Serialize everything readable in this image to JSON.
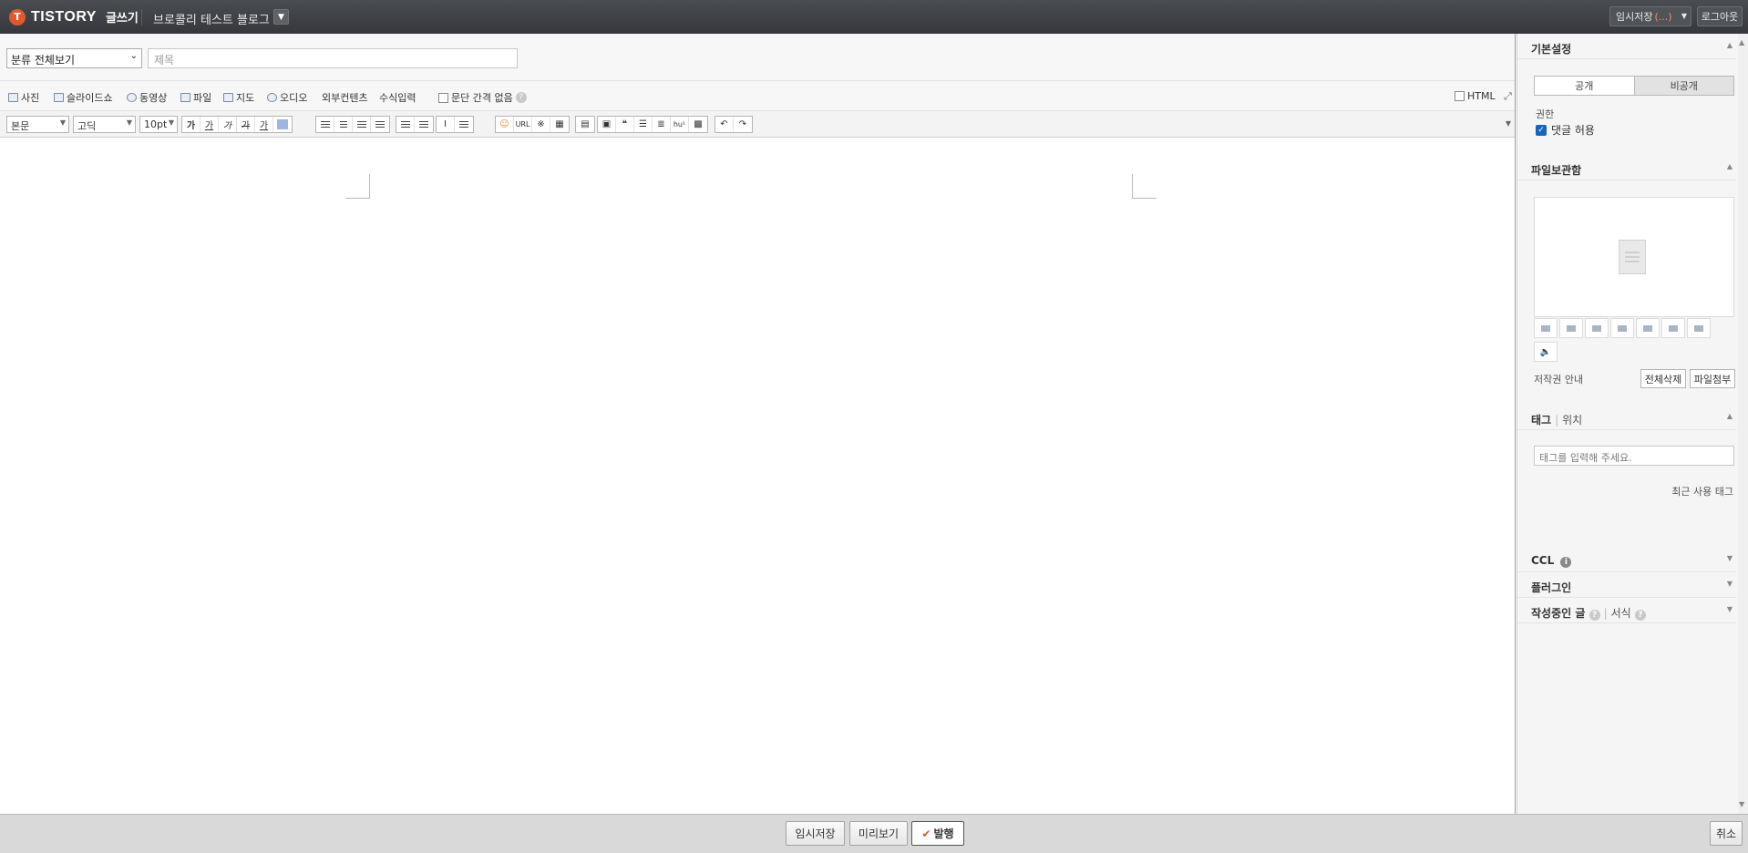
{
  "topbar": {
    "logo_text": "TISTORY",
    "logo_mark": "T",
    "logo_sub": "글쓰기",
    "blog_name": "브로콜리 테스트 블로그",
    "temp_save_label": "임시저장",
    "temp_save_count": "(...)",
    "logout_label": "로그아웃"
  },
  "editor": {
    "category_value": "분류 전체보기",
    "title_placeholder": "제목",
    "insert": {
      "photo": "사진",
      "slideshow": "슬라이드쇼",
      "video": "동영상",
      "file": "파일",
      "map": "지도",
      "audio": "오디오",
      "external": "외부컨텐츠",
      "formula": "수식입력",
      "no_paragraph_spacing": "문단 간격 없음",
      "html": "HTML"
    },
    "format": {
      "paragraph_style": "본문",
      "font": "고딕",
      "font_size": "10pt",
      "bold": "가",
      "underline": "가",
      "italic": "가",
      "strike": "가",
      "color": "가",
      "link_url": "URL",
      "hanja": "hu¹"
    }
  },
  "sidebar": {
    "basic_settings": "기본설정",
    "public_label": "공개",
    "private_label": "비공개",
    "permission_label": "권한",
    "allow_comments_label": "댓글 허용",
    "file_storage": "파일보관함",
    "copyright_label": "저작권 안내",
    "delete_all_label": "전체삭제",
    "attach_file_label": "파일첨부",
    "tag_label": "태그",
    "location_label": "위치",
    "tag_placeholder": "태그를 입력해 주세요.",
    "recent_tags_label": "최근 사용 태그",
    "ccl_label": "CCL",
    "plugin_label": "플러그인",
    "drafts_label": "작성중인 글",
    "template_label": "서식"
  },
  "bottombar": {
    "temp_save": "임시저장",
    "preview": "미리보기",
    "publish": "발행",
    "cancel": "취소"
  },
  "colors": {
    "brand": "#e4572e",
    "topbar": "#3c3f43",
    "checkbox": "#1565c0"
  }
}
